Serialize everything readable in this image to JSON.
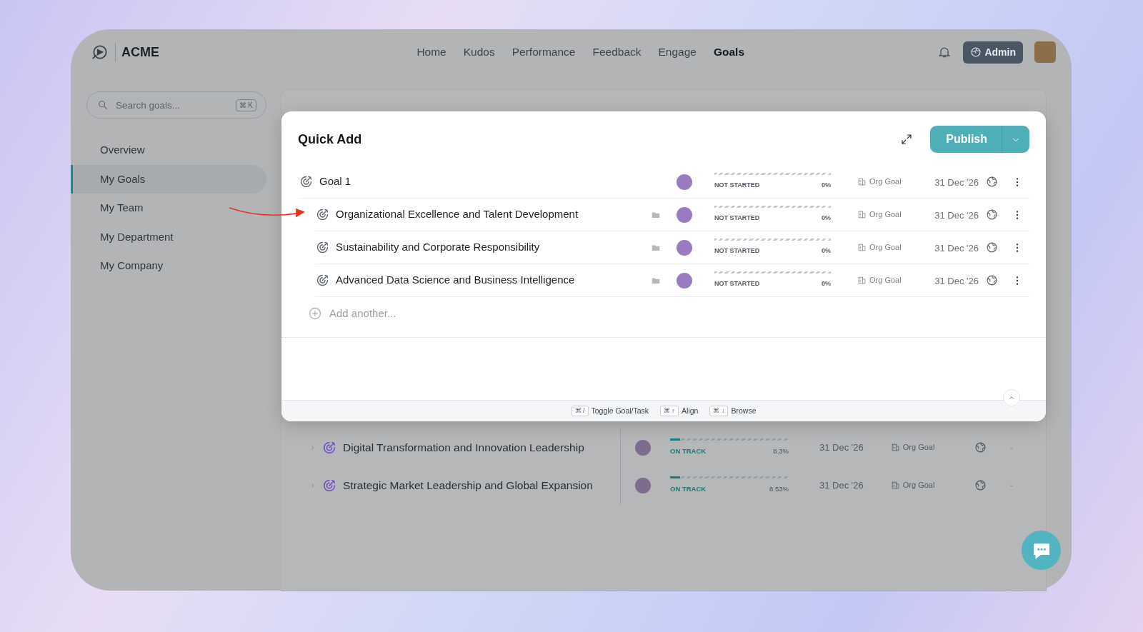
{
  "header": {
    "brand": "ACME",
    "nav": [
      {
        "label": "Home",
        "selected": false
      },
      {
        "label": "Kudos",
        "selected": false
      },
      {
        "label": "Performance",
        "selected": false
      },
      {
        "label": "Feedback",
        "selected": false
      },
      {
        "label": "Engage",
        "selected": false
      },
      {
        "label": "Goals",
        "selected": true
      }
    ],
    "admin_button": "Admin"
  },
  "sidebar": {
    "search": {
      "placeholder": "Search goals...",
      "shortcut": "⌘ K"
    },
    "items": [
      {
        "label": "Overview",
        "selected": false
      },
      {
        "label": "My Goals",
        "selected": true
      },
      {
        "label": "My Team",
        "selected": false
      },
      {
        "label": "My Department",
        "selected": false
      },
      {
        "label": "My Company",
        "selected": false
      }
    ]
  },
  "goals_list": {
    "rows": [
      {
        "title": "Digital Transformation and Innovation Leadership",
        "status": "ON TRACK",
        "level": 0.083,
        "percent": "8.3%",
        "due": "31 Dec '26",
        "type": "Org Goal"
      },
      {
        "title": "Strategic Market Leadership and Global Expansion",
        "status": "ON TRACK",
        "level": 0.0853,
        "percent": "8.53%",
        "due": "31 Dec '26",
        "type": "Org Goal"
      }
    ]
  },
  "quick_add": {
    "title": "Quick Add",
    "publish_button": "Publish",
    "goals": [
      {
        "title": "Goal 1",
        "status": "NOT STARTED",
        "level": 0,
        "percent": "0%",
        "type": "Org Goal",
        "due": "31 Dec '26",
        "children": [
          {
            "title": "Organizational Excellence and Talent Development",
            "status": "NOT STARTED",
            "level": 0,
            "percent": "0%",
            "type": "Org Goal",
            "due": "31 Dec '26"
          },
          {
            "title": "Sustainability and Corporate Responsibility",
            "status": "NOT STARTED",
            "level": 0,
            "percent": "0%",
            "type": "Org Goal",
            "due": "31 Dec '26"
          },
          {
            "title": "Advanced Data Science and Business Intelligence",
            "status": "NOT STARTED",
            "level": 0,
            "percent": "0%",
            "type": "Org Goal",
            "due": "31 Dec '26"
          }
        ]
      }
    ],
    "add_placeholder": "Add another...",
    "shortcuts": [
      {
        "keys": "⌘ /",
        "label": "Toggle Goal/Task"
      },
      {
        "keys": "⌘ ↑",
        "label": "Align"
      },
      {
        "keys": "⌘ ↓",
        "label": "Browse"
      }
    ]
  }
}
